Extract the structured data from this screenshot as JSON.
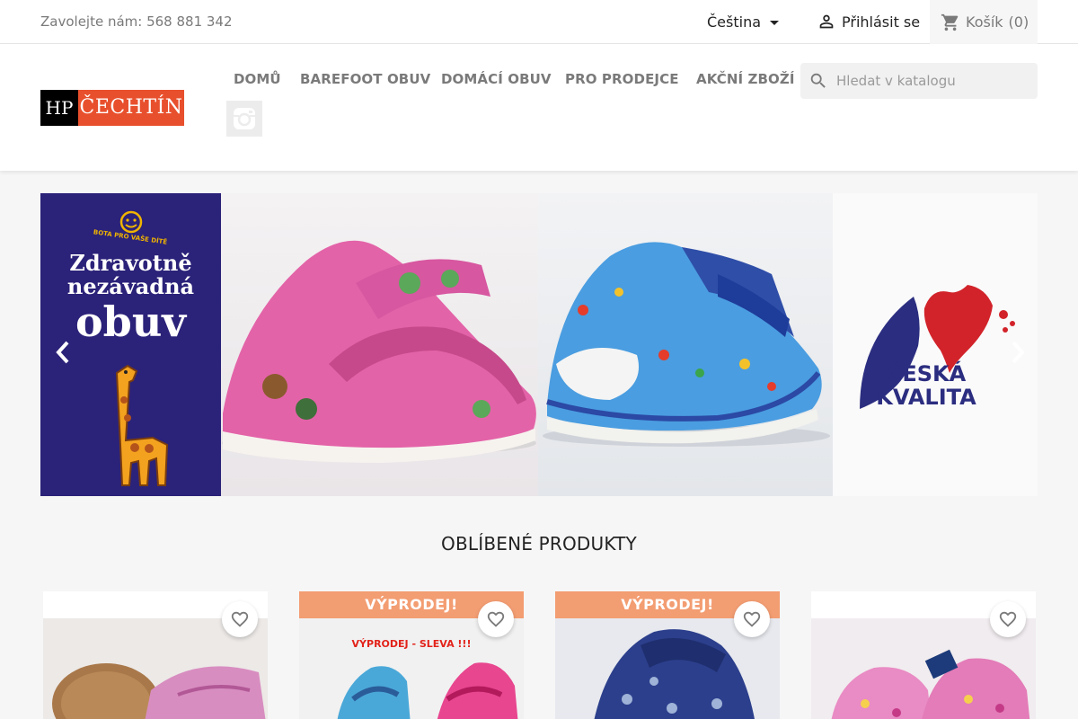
{
  "topbar": {
    "contact": "Zavolejte nám: 568 881 342",
    "language": "Čeština",
    "signin": "Přihlásit se",
    "cart": "Košík",
    "cart_count": "(0)"
  },
  "header": {
    "logo": {
      "left": "HP",
      "right": "ČECHTÍN"
    },
    "nav": [
      "DOMŮ",
      "BAREFOOT OBUV",
      "DOMÁCÍ OBUV",
      "PRO PRODEJCE",
      "AKČNÍ ZBOŽÍ"
    ],
    "search": {
      "placeholder": "Hledat v katalogu"
    }
  },
  "banner": {
    "panel1": {
      "brand": "BOTA PRO VAŠE DÍTĚ",
      "line1": "Zdravotně",
      "line2": "nezávadná",
      "line3": "obuv"
    },
    "panel4": {
      "line1": "ČESKÁ",
      "line2": "KVALITA"
    }
  },
  "section": {
    "title": "OBLÍBENÉ PRODUKTY"
  },
  "products": [
    {
      "sale": ""
    },
    {
      "sale": "VÝPRODEJ!",
      "image_text": "VÝPRODEJ - SLEVA !!!"
    },
    {
      "sale": "VÝPRODEJ!"
    },
    {
      "sale": ""
    }
  ],
  "colors": {
    "accent": "#e8502d",
    "sale": "#f39d72",
    "banner_blue": "#2b2279",
    "czech_quality_blue": "#2b2d80",
    "czech_quality_red": "#d2232a"
  }
}
